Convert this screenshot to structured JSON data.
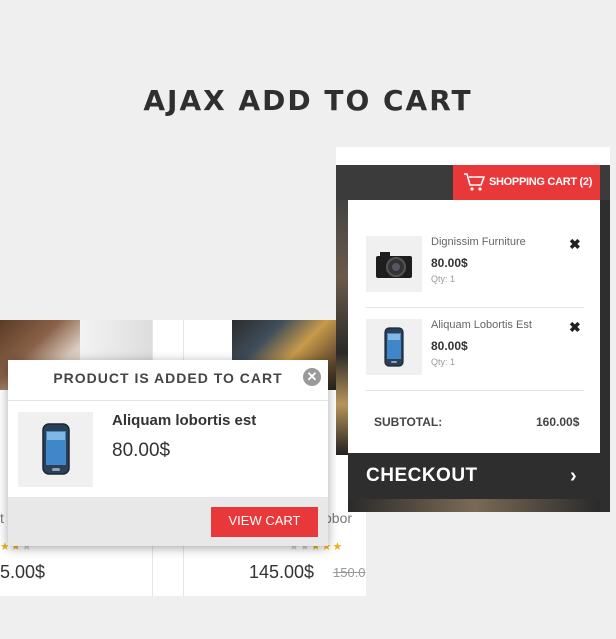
{
  "headline": "AJAX ADD TO CART",
  "grid": {
    "left_name": "t",
    "left_price": "5.00$",
    "right_name": "obor",
    "right_price": "145.00$",
    "right_old_price": "150.0"
  },
  "popup": {
    "title": "PRODUCT IS ADDED TO CART",
    "close": "✕",
    "product_name": "Aliquam lobortis est",
    "product_price": "80.00$",
    "view_cart_label": "VIEW CART"
  },
  "cart": {
    "button_label": "SHOPPING CART",
    "count": "(2)",
    "items": [
      {
        "name": "Dignissim Furniture",
        "price": "80.00$",
        "qty": "Qty: 1",
        "thumb": "camera-icon"
      },
      {
        "name": "Aliquam Lobortis Est",
        "price": "80.00$",
        "qty": "Qty: 1",
        "thumb": "phone-icon"
      }
    ],
    "remove_glyph": "✖",
    "subtotal_label": "SUBTOTAL:",
    "subtotal_value": "160.00$",
    "checkout_label": "CHECKOUT",
    "checkout_chevron": "›"
  },
  "colors": {
    "accent": "#e8383a",
    "dark": "#2e2e2e",
    "background": "#efefef"
  }
}
